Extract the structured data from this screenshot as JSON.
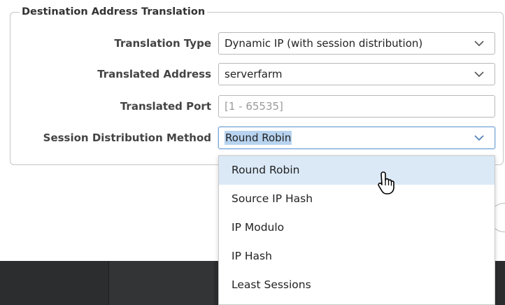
{
  "fieldset": {
    "legend": "Destination Address Translation"
  },
  "fields": {
    "translation_type": {
      "label": "Translation Type",
      "value": "Dynamic IP (with session distribution)"
    },
    "translated_address": {
      "label": "Translated Address",
      "value": "serverfarm"
    },
    "translated_port": {
      "label": "Translated Port",
      "placeholder": "[1 - 65535]"
    },
    "session_distribution_method": {
      "label": "Session Distribution Method",
      "value": "Round Robin"
    }
  },
  "dropdown": {
    "options": [
      "Round Robin",
      "Source IP Hash",
      "IP Modulo",
      "IP Hash",
      "Least Sessions"
    ],
    "hovered_index": 0
  },
  "colors": {
    "selection_highlight": "#b7d3ef",
    "hover_row": "#dbe9f7",
    "bottom_bar": "#2c2d2f"
  },
  "icons": {
    "select_arrow": "chevron-down-icon",
    "cursor": "hand-pointer-icon"
  }
}
